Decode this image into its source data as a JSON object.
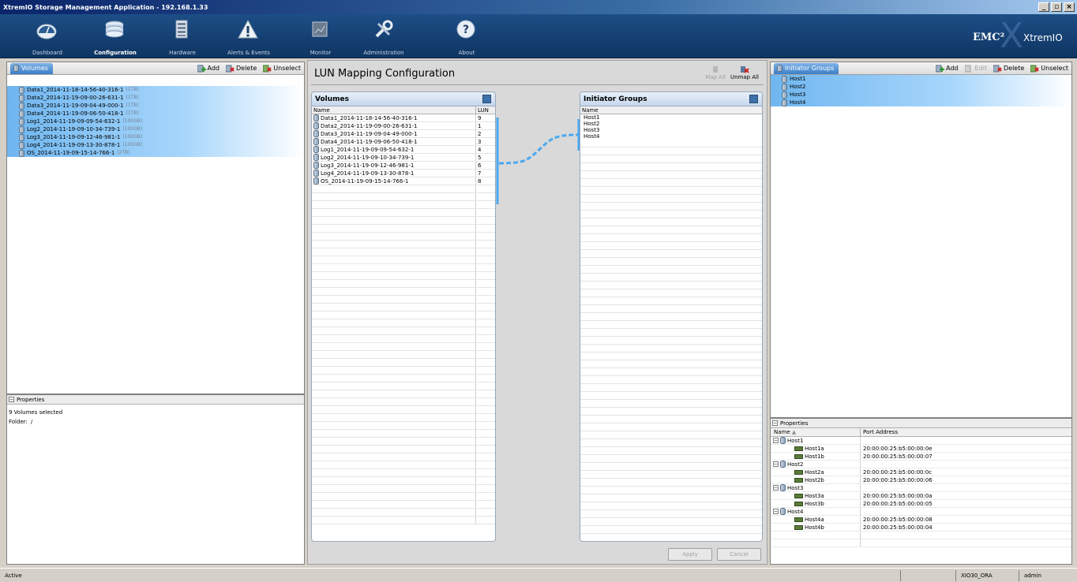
{
  "window": {
    "title": "XtremIO Storage Management Application - 192.168.1.33"
  },
  "nav": {
    "items": [
      {
        "label": "Dashboard"
      },
      {
        "label": "Configuration"
      },
      {
        "label": "Hardware"
      },
      {
        "label": "Alerts & Events"
      },
      {
        "label": "Monitor"
      },
      {
        "label": "Administration"
      },
      {
        "label": "About"
      }
    ],
    "active": "Configuration",
    "brand": {
      "emc": "EMC²",
      "product": "XtremIO"
    }
  },
  "left_panel": {
    "tab": "Volumes",
    "tools": {
      "add": "Add",
      "delete": "Delete",
      "unselect": "Unselect"
    },
    "volumes": [
      {
        "name": "Data1_2014-11-18-14-56-40-316-1",
        "size": "(1TB)"
      },
      {
        "name": "Data2_2014-11-19-09-00-26-631-1",
        "size": "(1TB)"
      },
      {
        "name": "Data3_2014-11-19-09-04-49-000-1",
        "size": "(1TB)"
      },
      {
        "name": "Data4_2014-11-19-09-06-50-418-1",
        "size": "(1TB)"
      },
      {
        "name": "Log1_2014-11-19-09-09-54-632-1",
        "size": "(100GB)"
      },
      {
        "name": "Log2_2014-11-19-09-10-34-739-1",
        "size": "(100GB)"
      },
      {
        "name": "Log3_2014-11-19-09-12-46-981-1",
        "size": "(100GB)"
      },
      {
        "name": "Log4_2014-11-19-09-13-30-878-1",
        "size": "(100GB)"
      },
      {
        "name": "OS_2014-11-19-09-15-14-766-1",
        "size": "(2TB)"
      }
    ],
    "properties": {
      "header": "Properties",
      "selected_text": "9 Volumes selected",
      "folder_label": "Folder:",
      "folder_value": "/"
    }
  },
  "center": {
    "title": "LUN Mapping Configuration",
    "tools": {
      "map_all": "Map All",
      "unmap_all": "Unmap All"
    },
    "volumes_grid": {
      "title": "Volumes",
      "col_name": "Name",
      "col_lun": "LUN",
      "rows": [
        {
          "name": "Data1_2014-11-18-14-56-40-316-1",
          "lun": "9"
        },
        {
          "name": "Data2_2014-11-19-09-00-26-631-1",
          "lun": "1"
        },
        {
          "name": "Data3_2014-11-19-09-04-49-000-1",
          "lun": "2"
        },
        {
          "name": "Data4_2014-11-19-09-06-50-418-1",
          "lun": "3"
        },
        {
          "name": "Log1_2014-11-19-09-09-54-632-1",
          "lun": "4"
        },
        {
          "name": "Log2_2014-11-19-09-10-34-739-1",
          "lun": "5"
        },
        {
          "name": "Log3_2014-11-19-09-12-46-981-1",
          "lun": "6"
        },
        {
          "name": "Log4_2014-11-19-09-13-30-878-1",
          "lun": "7"
        },
        {
          "name": "OS_2014-11-19-09-15-14-766-1",
          "lun": "8"
        }
      ]
    },
    "ig_grid": {
      "title": "Initiator Groups",
      "col_name": "Name",
      "rows": [
        {
          "name": "Host1"
        },
        {
          "name": "Host2"
        },
        {
          "name": "Host3"
        },
        {
          "name": "Host4"
        }
      ]
    },
    "buttons": {
      "apply": "Apply",
      "cancel": "Cancel"
    }
  },
  "right_panel": {
    "tab": "Initiator Groups",
    "tools": {
      "add": "Add",
      "edit": "Edit",
      "delete": "Delete",
      "unselect": "Unselect"
    },
    "groups": [
      "Host1",
      "Host2",
      "Host3",
      "Host4"
    ],
    "properties": {
      "header": "Properties",
      "col_name": "Name",
      "col_port": "Port Address",
      "hosts": [
        {
          "name": "Host1",
          "initiators": [
            {
              "name": "Host1a",
              "port": "20:00:00:25:b5:00:00:0e"
            },
            {
              "name": "Host1b",
              "port": "20:00:00:25:b5:00:00:07"
            }
          ]
        },
        {
          "name": "Host2",
          "initiators": [
            {
              "name": "Host2a",
              "port": "20:00:00:25:b5:00:00:0c"
            },
            {
              "name": "Host2b",
              "port": "20:00:00:25:b5:00:00:06"
            }
          ]
        },
        {
          "name": "Host3",
          "initiators": [
            {
              "name": "Host3a",
              "port": "20:00:00:25:b5:00:00:0a"
            },
            {
              "name": "Host3b",
              "port": "20:00:00:25:b5:00:00:05"
            }
          ]
        },
        {
          "name": "Host4",
          "initiators": [
            {
              "name": "Host4a",
              "port": "20:00:00:25:b5:00:00:08"
            },
            {
              "name": "Host4b",
              "port": "20:00:00:25:b5:00:00:04"
            }
          ]
        }
      ]
    }
  },
  "status": {
    "state": "Active",
    "cluster": "XIO30_ORA",
    "user": "admin"
  },
  "colors": {
    "accent": "#3d7fc7",
    "selection": "#6fb6f0",
    "nav_bg": "#1d4e86",
    "link_line": "#4aa8f0"
  }
}
